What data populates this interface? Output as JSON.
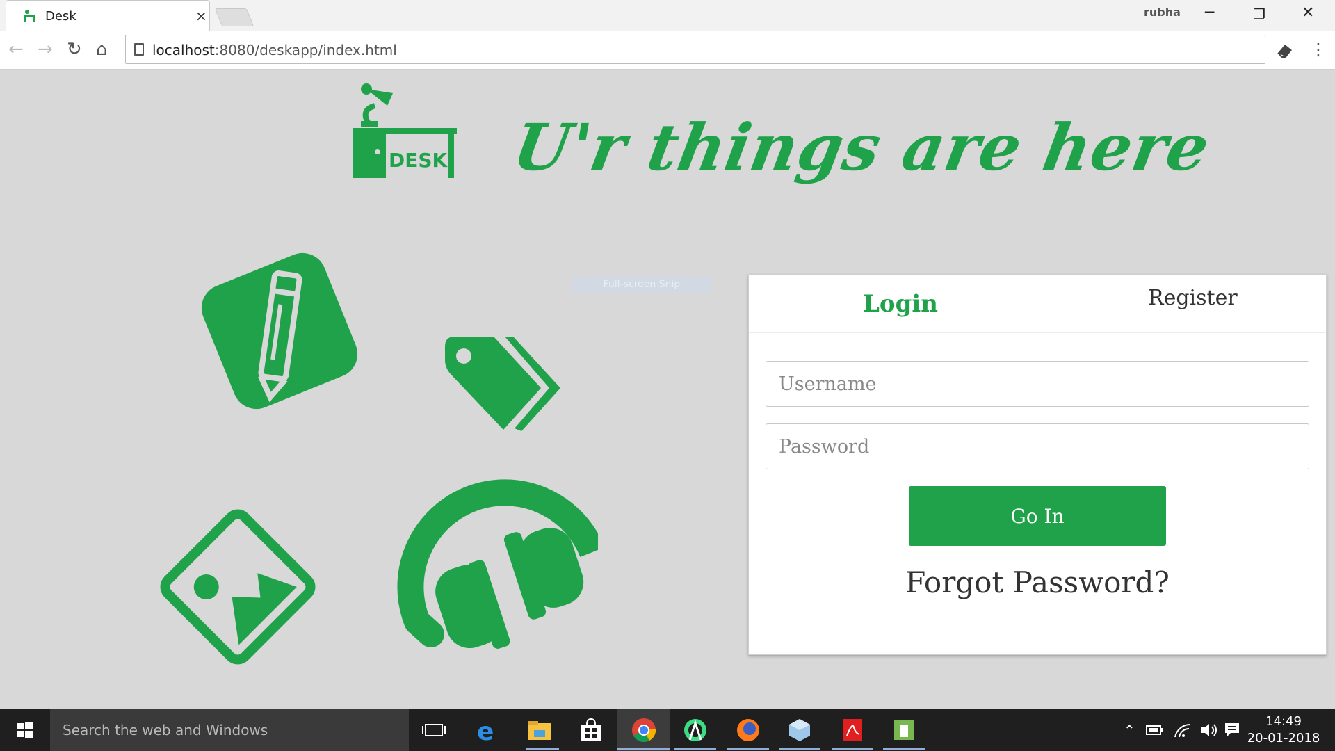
{
  "browser": {
    "tab_title": "Desk",
    "tab_close": "×",
    "profile_name": "rubha",
    "url_host": "localhost",
    "url_rest": ":8080/deskapp/index.html",
    "controls": {
      "minimize": "─",
      "restore": "❐",
      "close": "✕"
    },
    "nav": {
      "back": "←",
      "forward": "→",
      "reload": "↻",
      "home": "⌂"
    },
    "menu": "⋮"
  },
  "page": {
    "logo_text": "DESK",
    "tagline": "U'r things are here",
    "ghost_text": "Full-screen Snip",
    "accent_color": "#1fa24a",
    "illustrations": [
      "pencil-note-icon",
      "tag-icon",
      "image-icon",
      "headphones-icon"
    ]
  },
  "login_card": {
    "tabs": {
      "login": "Login",
      "register": "Register"
    },
    "username_placeholder": "Username",
    "password_placeholder": "Password",
    "submit_label": "Go In",
    "forgot_label": "Forgot Password?"
  },
  "taskbar": {
    "search_placeholder": "Search the web and Windows",
    "time": "14:49",
    "date": "20-01-2018",
    "apps": [
      "task-view",
      "edge",
      "file-explorer",
      "store",
      "chrome",
      "android-studio",
      "firefox",
      "virtualbox",
      "acrobat",
      "notepad"
    ]
  }
}
